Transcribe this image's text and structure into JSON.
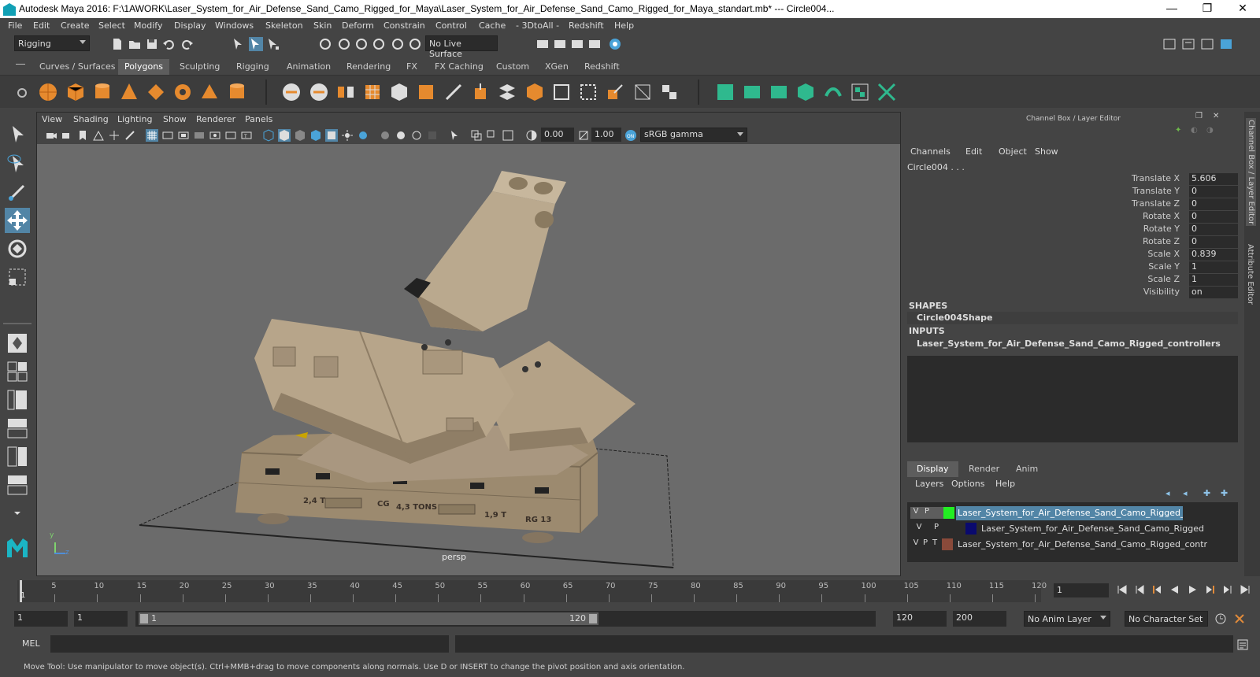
{
  "window": {
    "title": "Autodesk Maya 2016: F:\\1AWORK\\Laser_System_for_Air_Defense_Sand_Camo_Rigged_for_Maya\\Laser_System_for_Air_Defense_Sand_Camo_Rigged_for_Maya_standart.mb*   ---   Circle004...",
    "minimize": "—",
    "maximize": "❐",
    "close": "✕"
  },
  "menubar": [
    "File",
    "Edit",
    "Create",
    "Select",
    "Modify",
    "Display",
    "Windows",
    "Skeleton",
    "Skin",
    "Deform",
    "Constrain",
    "Control",
    "Cache",
    "- 3DtoAll -",
    "Redshift",
    "Help"
  ],
  "statusline": {
    "mode": "Rigging",
    "live_surface": "No Live Surface"
  },
  "shelf_tabs": [
    {
      "label": "Curves / Surfaces",
      "active": false
    },
    {
      "label": "Polygons",
      "active": true
    },
    {
      "label": "Sculpting",
      "active": false
    },
    {
      "label": "Rigging",
      "active": false
    },
    {
      "label": "Animation",
      "active": false
    },
    {
      "label": "Rendering",
      "active": false
    },
    {
      "label": "FX",
      "active": false
    },
    {
      "label": "FX Caching",
      "active": false
    },
    {
      "label": "Custom",
      "active": false
    },
    {
      "label": "XGen",
      "active": false
    },
    {
      "label": "Redshift",
      "active": false
    }
  ],
  "panel_menu": [
    "View",
    "Shading",
    "Lighting",
    "Show",
    "Renderer",
    "Panels"
  ],
  "panel_fields": {
    "exposure": "0.00",
    "gamma": "1.00",
    "color_space": "sRGB gamma"
  },
  "viewport": {
    "camera_label": "persp",
    "decal_text": [
      "2,4 T",
      "CG",
      "4,3 TONS",
      "1,9 T",
      "RG 13"
    ],
    "axis_y": "y",
    "axis_z": "z"
  },
  "channel_box": {
    "title": "Channel Box / Layer Editor",
    "menus": [
      "Channels",
      "Edit",
      "Object",
      "Show"
    ],
    "object_name": "Circle004 . . .",
    "attributes": [
      {
        "label": "Translate X",
        "value": "5.606"
      },
      {
        "label": "Translate Y",
        "value": "0"
      },
      {
        "label": "Translate Z",
        "value": "0"
      },
      {
        "label": "Rotate X",
        "value": "0"
      },
      {
        "label": "Rotate Y",
        "value": "0"
      },
      {
        "label": "Rotate Z",
        "value": "0"
      },
      {
        "label": "Scale X",
        "value": "0.839"
      },
      {
        "label": "Scale Y",
        "value": "1"
      },
      {
        "label": "Scale Z",
        "value": "1"
      },
      {
        "label": "Visibility",
        "value": "on"
      }
    ],
    "shapes_header": "SHAPES",
    "shape_name": "Circle004Shape",
    "inputs_header": "INPUTS",
    "input_name": "Laser_System_for_Air_Defense_Sand_Camo_Rigged_controllers"
  },
  "layer_editor": {
    "tabs": [
      {
        "label": "Display",
        "active": true
      },
      {
        "label": "Render",
        "active": false
      },
      {
        "label": "Anim",
        "active": false
      }
    ],
    "menus": [
      "Layers",
      "Options",
      "Help"
    ],
    "layers": [
      {
        "v": "V",
        "p": "P",
        "t": "",
        "color": "#22ee22",
        "name": "Laser_System_for_Air_Defense_Sand_Camo_Rigged_contr",
        "selected": true
      },
      {
        "v": "V",
        "p": "P",
        "t": "",
        "color": "#0a0a6e",
        "name": "Laser_System_for_Air_Defense_Sand_Camo_Rigged",
        "selected": false
      },
      {
        "v": "V",
        "p": "P",
        "t": "T",
        "color": "#8a4a3a",
        "name": "Laser_System_for_Air_Defense_Sand_Camo_Rigged_contr",
        "selected": false
      }
    ]
  },
  "side_tabs": [
    "Channel Box / Layer Editor",
    "Attribute Editor"
  ],
  "timeline": {
    "ticks": [
      "5",
      "10",
      "15",
      "20",
      "25",
      "30",
      "35",
      "40",
      "45",
      "50",
      "55",
      "60",
      "65",
      "70",
      "75",
      "80",
      "85",
      "90",
      "95",
      "100",
      "105",
      "110",
      "115",
      "120"
    ],
    "current_frame_marker": "1",
    "current_frame": "1"
  },
  "range": {
    "start": "1",
    "playback_start": "1",
    "slider_start": "1",
    "slider_end": "120",
    "playback_end": "120",
    "end": "200",
    "anim_layer": "No Anim Layer",
    "character_set": "No Character Set"
  },
  "command_line": {
    "label": "MEL"
  },
  "help_line": "Move Tool: Use manipulator to move object(s). Ctrl+MMB+drag to move components along normals. Use D or INSERT to change the pivot position and axis orientation."
}
